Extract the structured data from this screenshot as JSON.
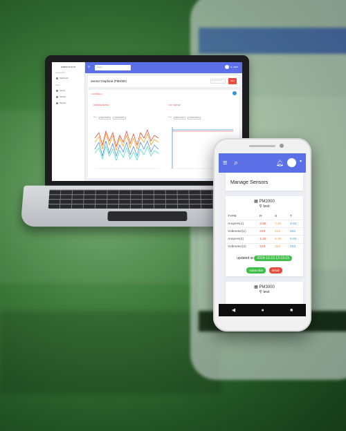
{
  "laptop": {
    "brand": "WEBSTATION",
    "nav_groups": [
      "DASHBOARD",
      "MENU"
    ],
    "nav_items": [
      "Dashboard",
      "Sensor",
      "Devices",
      "Reports"
    ],
    "search_placeholder": "Search",
    "user": "ID_USER",
    "page_title": "Sensor Graphical (PM2000)",
    "select_placeholder": "Choose Sensor",
    "back_label": "Back",
    "channel_label": "CHANNEL 1",
    "charts": [
      {
        "title": "AMPERE METER",
        "range_label": "Date",
        "from": "Mar 1, 2019",
        "to": "Oct 20, 2019"
      },
      {
        "title": "VOLT METER",
        "range_label": "Date",
        "from": "Mar 1, 2019",
        "to": "Oct 20, 2019"
      }
    ]
  },
  "phone": {
    "page_title": "Manage Sensors",
    "cards": [
      {
        "name": "PM2000",
        "location": "test",
        "headers": [
          "TYPE",
          "R",
          "S",
          "T"
        ],
        "rows": [
          {
            "type": "Ampere(1)",
            "r": "3.68",
            "s": "7.24",
            "t": "3.03"
          },
          {
            "type": "Voltmeter(1)",
            "r": "220",
            "s": "222",
            "t": "221"
          },
          {
            "type": "Ampere(2)",
            "r": "1.45",
            "s": "5.75",
            "t": "0.00"
          },
          {
            "type": "Voltmeter(2)",
            "r": "223",
            "s": "224",
            "t": "222"
          }
        ],
        "updated_label": "updated at",
        "updated_at": "2019-10-23 13:19:23",
        "subscribe_label": "subscribe",
        "detail_label": "detail"
      },
      {
        "name": "PM3000",
        "location": "test"
      }
    ]
  },
  "colors": {
    "topbar": "#5b6fe6",
    "success": "#3fbf4a",
    "danger": "#e74c3c",
    "warn": "#e6a23c",
    "info": "#3498db"
  }
}
